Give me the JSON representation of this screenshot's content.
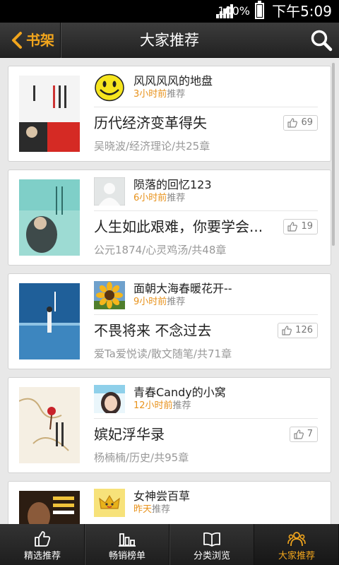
{
  "status": {
    "battery": "100%",
    "time": "下午5:09"
  },
  "header": {
    "back_label": "书架",
    "title": "大家推荐"
  },
  "feed": [
    {
      "user": "风风风风的地盘",
      "time": "3小时前",
      "action": "推荐",
      "book_title": "历代经济变革得失",
      "likes": "69",
      "info": "吴晓波/经济理论/共25章",
      "avatar": "smiley-avatar"
    },
    {
      "user": "陨落的回忆123",
      "time": "6小时前",
      "action": "推荐",
      "book_title": "人生如此艰难，你要学会...",
      "likes": "19",
      "info": "公元1874/心灵鸡汤/共48章",
      "avatar": "default-avatar"
    },
    {
      "user": "面朝大海春暖花开--",
      "time": "9小时前",
      "action": "推荐",
      "book_title": "不畏将来 不念过去",
      "likes": "126",
      "info": "爱Ta爱悦读/散文随笔/共71章",
      "avatar": "sunflower-avatar"
    },
    {
      "user": "青春Candy的小窝",
      "time": "12小时前",
      "action": "推荐",
      "book_title": "嫔妃浮华录",
      "likes": "7",
      "info": "杨楠楠/历史/共95章",
      "avatar": "girl-avatar"
    },
    {
      "user": "女神尝百草",
      "time": "昨天",
      "action": "推荐",
      "book_title": "",
      "likes": "",
      "info": "",
      "avatar": "crown-avatar"
    }
  ],
  "tabs": [
    {
      "label": "精选推荐",
      "icon": "thumbs-up-icon"
    },
    {
      "label": "畅销榜单",
      "icon": "bar-chart-icon"
    },
    {
      "label": "分类浏览",
      "icon": "open-book-icon"
    },
    {
      "label": "大家推荐",
      "icon": "people-icon",
      "active": true
    }
  ],
  "colors": {
    "accent": "#f1a51d",
    "time_text": "#e8921b",
    "bar": "#2a2a2a"
  }
}
